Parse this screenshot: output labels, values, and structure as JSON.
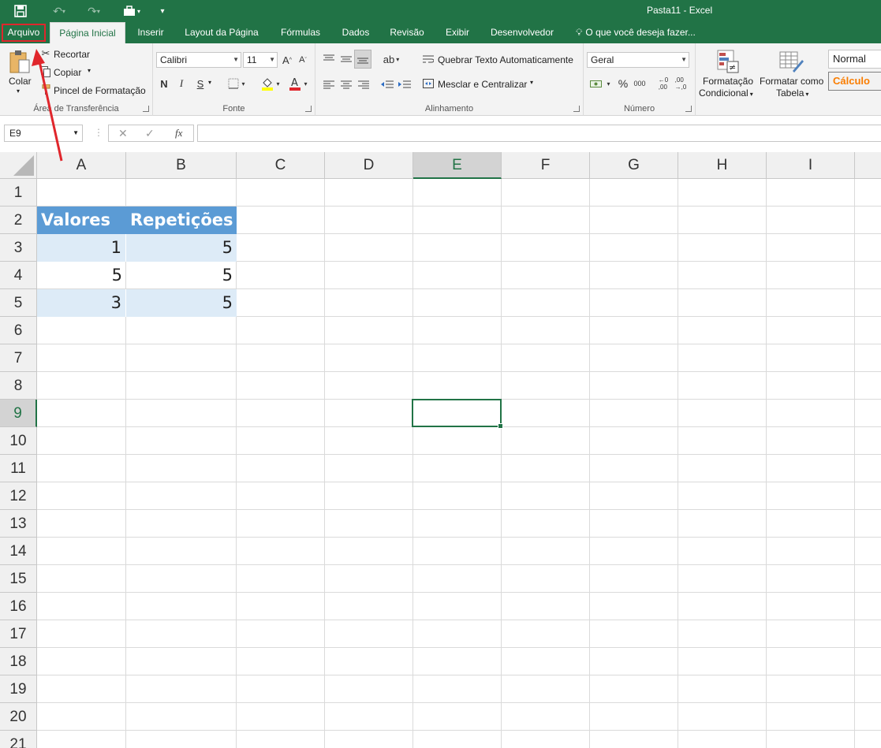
{
  "window": {
    "title": "Pasta11 - Excel"
  },
  "quick_access": {
    "save_icon": "save-icon",
    "undo_icon": "undo-icon",
    "redo_icon": "redo-icon",
    "toolbox_icon": "toolbox-icon",
    "customize_icon": "customize-icon"
  },
  "tabs": [
    {
      "label": "Arquivo"
    },
    {
      "label": "Página Inicial"
    },
    {
      "label": "Inserir"
    },
    {
      "label": "Layout da Página"
    },
    {
      "label": "Fórmulas"
    },
    {
      "label": "Dados"
    },
    {
      "label": "Revisão"
    },
    {
      "label": "Exibir"
    },
    {
      "label": "Desenvolvedor"
    }
  ],
  "tell_me": {
    "placeholder": "O que você deseja fazer..."
  },
  "ribbon": {
    "clipboard": {
      "paste": "Colar",
      "cut": "Recortar",
      "copy": "Copiar",
      "format_painter": "Pincel de Formatação",
      "label": "Área de Transferência"
    },
    "font": {
      "name": "Calibri",
      "size": "11",
      "bold": "N",
      "italic": "I",
      "underline": "S",
      "label": "Fonte"
    },
    "alignment": {
      "wrap": "Quebrar Texto Automaticamente",
      "merge": "Mesclar e Centralizar",
      "label": "Alinhamento"
    },
    "number": {
      "format": "Geral",
      "percent": "%",
      "thousands": "000",
      "label": "Número"
    },
    "styles": {
      "conditional": "Formatação Condicional",
      "conditional_line1": "Formatação",
      "conditional_line2": "Condicional",
      "as_table_line1": "Formatar como",
      "as_table_line2": "Tabela",
      "normal": "Normal",
      "calc": "Cálculo"
    }
  },
  "formula_bar": {
    "name_box": "E9",
    "cancel": "✕",
    "enter": "✓",
    "fx": "fx",
    "value": ""
  },
  "columns": [
    "A",
    "B",
    "C",
    "D",
    "E",
    "F",
    "G",
    "H",
    "I"
  ],
  "rows": [
    "1",
    "2",
    "3",
    "4",
    "5",
    "6",
    "7",
    "8",
    "9",
    "10",
    "11",
    "12",
    "13",
    "14",
    "15",
    "16",
    "17",
    "18",
    "19",
    "20",
    "21"
  ],
  "selected_cell": "E9",
  "table": {
    "headers": [
      "Valores",
      "Repetições"
    ],
    "rows": [
      [
        "1",
        "5"
      ],
      [
        "5",
        "5"
      ],
      [
        "3",
        "5"
      ]
    ]
  },
  "colors": {
    "excel_green": "#217346",
    "table_header": "#5b9bd5",
    "table_band": "#ddebf7",
    "annotation": "#e0262c"
  }
}
